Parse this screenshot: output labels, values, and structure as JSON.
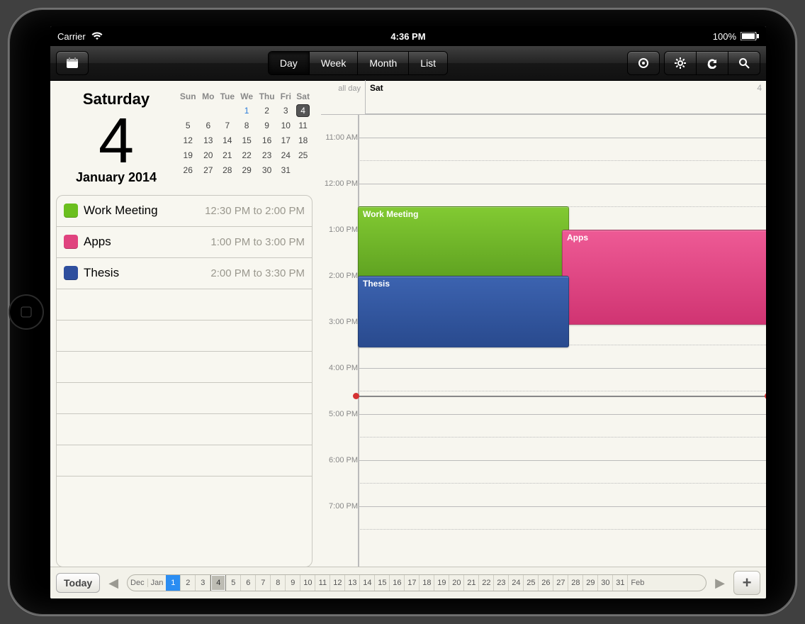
{
  "status": {
    "carrier": "Carrier",
    "time": "4:36 PM",
    "battery": "100%"
  },
  "toolbar": {
    "views": [
      "Day",
      "Week",
      "Month",
      "List"
    ],
    "active": 0
  },
  "date": {
    "dow": "Saturday",
    "num": "4",
    "month_year": "January 2014"
  },
  "mini": {
    "headers": [
      "Sun",
      "Mo",
      "Tue",
      "We",
      "Thu",
      "Fri",
      "Sat"
    ],
    "weeks": [
      [
        "",
        "",
        "",
        "1",
        "2",
        "3",
        "4"
      ],
      [
        "5",
        "6",
        "7",
        "8",
        "9",
        "10",
        "11"
      ],
      [
        "12",
        "13",
        "14",
        "15",
        "16",
        "17",
        "18"
      ],
      [
        "19",
        "20",
        "21",
        "22",
        "23",
        "24",
        "25"
      ],
      [
        "26",
        "27",
        "28",
        "29",
        "30",
        "31",
        ""
      ]
    ],
    "blue": "1",
    "selected": "4"
  },
  "events": [
    {
      "title": "Work Meeting",
      "time": "12:30 PM to 2:00 PM",
      "color": "#6bbf1e"
    },
    {
      "title": "Apps",
      "time": "1:00 PM to 3:00 PM",
      "color": "#e0437e"
    },
    {
      "title": "Thesis",
      "time": "2:00 PM to 3:30 PM",
      "color": "#2f4f9e"
    }
  ],
  "dayview": {
    "allday_label": "all day",
    "allday_day": "Sat",
    "allday_num": "4",
    "start_hour": 10.5,
    "hour_height": 65,
    "now_hour": 16.6,
    "hours": [
      "11:00 AM",
      "12:00 PM",
      "1:00 PM",
      "2:00 PM",
      "3:00 PM",
      "4:00 PM",
      "5:00 PM",
      "6:00 PM",
      "7:00 PM"
    ],
    "events": [
      {
        "title": "Work Meeting",
        "start": 12.5,
        "end": 14,
        "col": 0,
        "cols": 2,
        "bg": "linear-gradient(#82ca32,#5fa221)"
      },
      {
        "title": "Apps",
        "start": 13,
        "end": 15,
        "col": 1,
        "cols": 2,
        "bg": "linear-gradient(#ee5a95,#d03472)"
      },
      {
        "title": "Thesis",
        "start": 14,
        "end": 15.5,
        "col": 0,
        "cols": 2,
        "bg": "linear-gradient(#3c63b0,#294a8e)"
      }
    ]
  },
  "bottom": {
    "today": "Today",
    "months_left": "Dec",
    "month": "Jan",
    "months_right": "Feb",
    "days": [
      "1",
      "2",
      "3",
      "4",
      "5",
      "6",
      "7",
      "8",
      "9",
      "10",
      "11",
      "12",
      "13",
      "14",
      "15",
      "16",
      "17",
      "18",
      "19",
      "20",
      "21",
      "22",
      "23",
      "24",
      "25",
      "26",
      "27",
      "28",
      "29",
      "30",
      "31"
    ],
    "blue": "1",
    "selected": "4"
  },
  "colors": {
    "green": "#6bbf1e",
    "pink": "#e0437e",
    "blue": "#2f4f9e"
  }
}
